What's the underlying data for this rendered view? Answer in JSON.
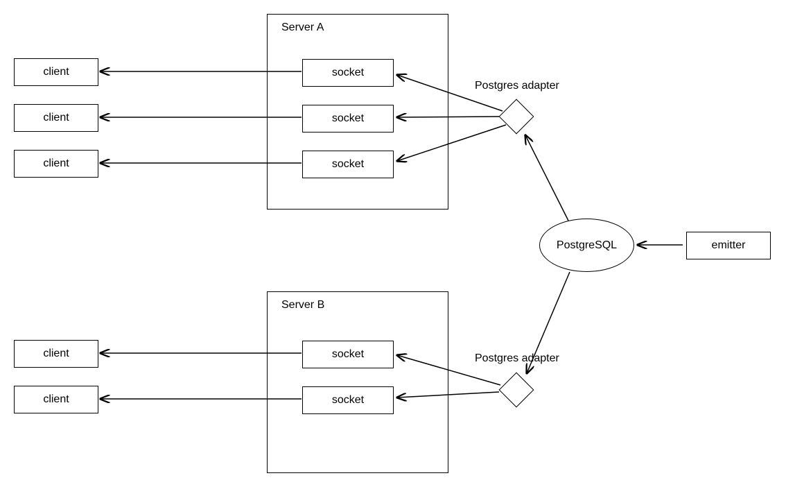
{
  "serverA": {
    "title": "Server A",
    "sockets": [
      "socket",
      "socket",
      "socket"
    ]
  },
  "serverB": {
    "title": "Server B",
    "sockets": [
      "socket",
      "socket"
    ]
  },
  "clientsA": [
    "client",
    "client",
    "client"
  ],
  "clientsB": [
    "client",
    "client"
  ],
  "adapterA": "Postgres adapter",
  "adapterB": "Postgres adapter",
  "database": "PostgreSQL",
  "emitter": "emitter"
}
